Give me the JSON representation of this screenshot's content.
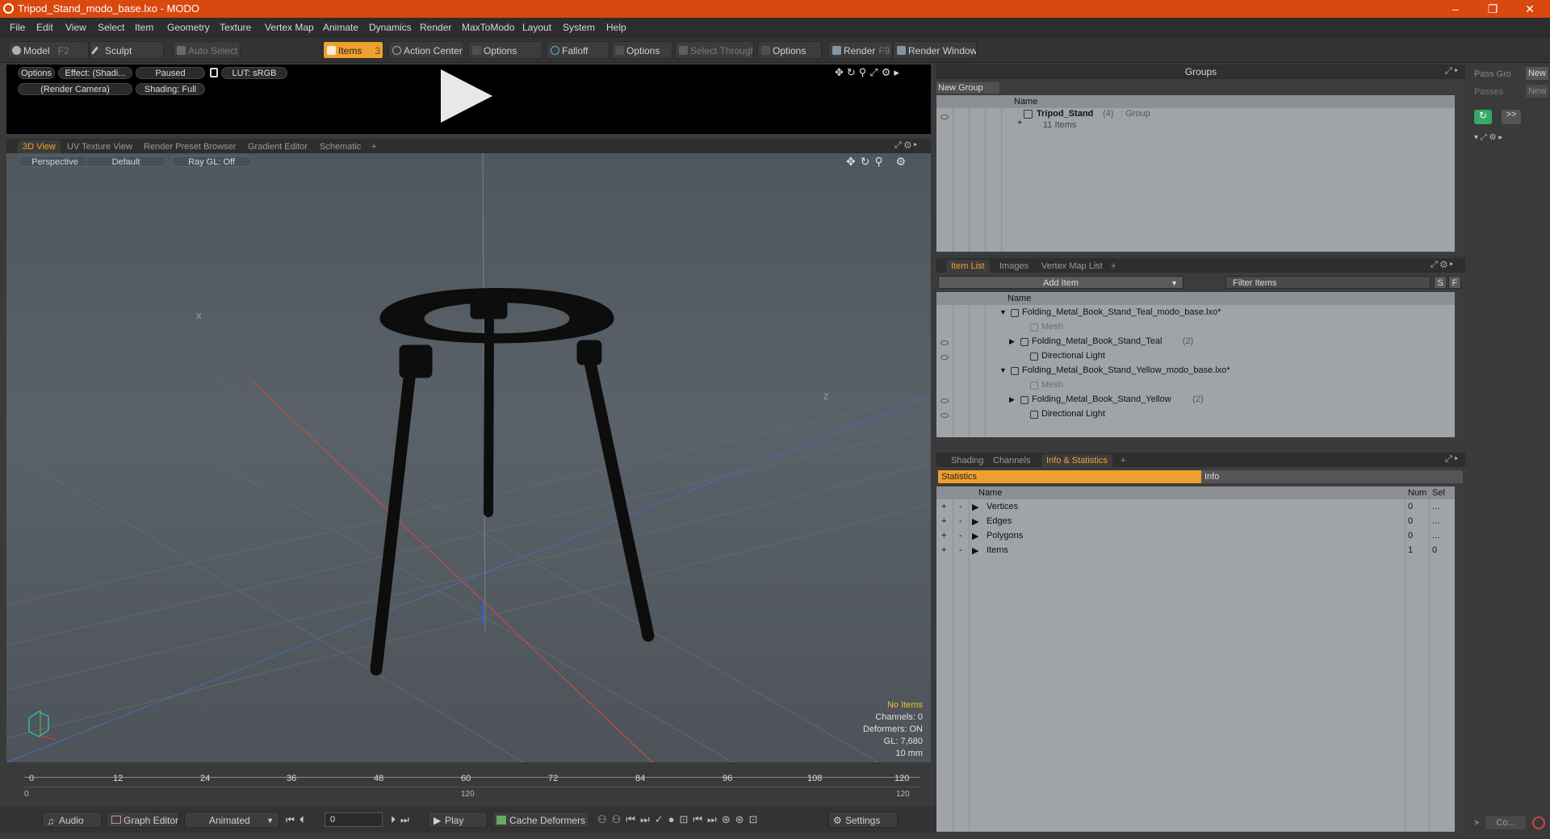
{
  "window": {
    "title": "Tripod_Stand_modo_base.lxo - MODO",
    "minimize": "–",
    "maximize": "❐",
    "close": "✕"
  },
  "menu": [
    "File",
    "Edit",
    "View",
    "Select",
    "Item",
    "Geometry",
    "Texture",
    "Vertex Map",
    "Animate",
    "Dynamics",
    "Render",
    "MaxToModo",
    "Layout",
    "System",
    "Help"
  ],
  "toolbar": {
    "model": "Model",
    "model_key": "F2",
    "sculpt": "Sculpt",
    "auto_select": "Auto Select",
    "items": "Items",
    "items_key": "3",
    "action_center": "Action Center",
    "options1": "Options",
    "falloff": "Falloff",
    "options2": "Options",
    "select_through": "Select Through",
    "options3": "Options",
    "render": "Render",
    "render_key": "F9",
    "render_window": "Render Window"
  },
  "preview": {
    "options": "Options",
    "effect": "Effect: (Shadi...",
    "paused": "Paused",
    "lut": "LUT: sRGB",
    "camera": "(Render Camera)",
    "shading": "Shading: Full"
  },
  "view_tabs": [
    "3D View",
    "UV Texture View",
    "Render Preset Browser",
    "Gradient Editor",
    "Schematic",
    "+"
  ],
  "viewport": {
    "perspective": "Perspective",
    "default": "Default",
    "raygl": "Ray GL: Off",
    "axis_x": "X",
    "axis_z": "Z",
    "stats": {
      "items": "No Items",
      "channels": "Channels: 0",
      "deformers": "Deformers: ON",
      "gl": "GL: 7,680",
      "scale": "10 mm"
    }
  },
  "timeline": {
    "ticks": [
      "0",
      "12",
      "24",
      "36",
      "48",
      "60",
      "72",
      "84",
      "96",
      "108",
      "120"
    ],
    "range_start": "0",
    "range_mid": "120",
    "range_end": "120"
  },
  "bottom": {
    "audio": "Audio",
    "graph_editor": "Graph Editor",
    "animated": "Animated",
    "frame": "0",
    "play": "Play",
    "cache": "Cache Deformers",
    "settings": "Settings"
  },
  "groups": {
    "title": "Groups",
    "new_group": "New Group",
    "col_name": "Name",
    "item_name": "Tripod_Stand",
    "item_count": "(4)",
    "item_type": ": Group",
    "item_sub": "11 Items"
  },
  "pass": {
    "pass_groups": "Pass Gro",
    "passes": "Passes",
    "new1": "New",
    "new2": "New",
    "more": ">>"
  },
  "itemlist": {
    "tabs": [
      "Item List",
      "Images",
      "Vertex Map List",
      "+"
    ],
    "add_item": "Add Item",
    "filter": "Filter Items",
    "s": "S",
    "f": "F",
    "col_name": "Name",
    "rows": [
      {
        "indent": 0,
        "label": "Folding_Metal_Book_Stand_Teal_modo_base.lxo*",
        "arrow": "▼",
        "dim": false
      },
      {
        "indent": 2,
        "label": "Mesh",
        "arrow": "",
        "dim": true
      },
      {
        "indent": 1,
        "label": "Folding_Metal_Book_Stand_Teal",
        "count": "(2)",
        "arrow": "▶",
        "dim": false
      },
      {
        "indent": 2,
        "label": "Directional Light",
        "arrow": "",
        "dim": false
      },
      {
        "indent": 0,
        "label": "Folding_Metal_Book_Stand_Yellow_modo_base.lxo*",
        "arrow": "▼",
        "dim": false
      },
      {
        "indent": 2,
        "label": "Mesh",
        "arrow": "",
        "dim": true
      },
      {
        "indent": 1,
        "label": "Folding_Metal_Book_Stand_Yellow",
        "count": "(2)",
        "arrow": "▶",
        "dim": false
      },
      {
        "indent": 2,
        "label": "Directional Light",
        "arrow": "",
        "dim": false
      }
    ]
  },
  "stats_panel": {
    "tabs": [
      "Shading",
      "Channels",
      "Info & Statistics",
      "+"
    ],
    "statistics": "Statistics",
    "info": "Info",
    "col_name": "Name",
    "col_num": "Num",
    "col_sel": "Sel",
    "rows": [
      {
        "name": "Vertices",
        "num": "0",
        "sel": "..."
      },
      {
        "name": "Edges",
        "num": "0",
        "sel": "..."
      },
      {
        "name": "Polygons",
        "num": "0",
        "sel": "..."
      },
      {
        "name": "Items",
        "num": "1",
        "sel": "0"
      }
    ]
  },
  "far_right": {
    "co": "Co..."
  }
}
